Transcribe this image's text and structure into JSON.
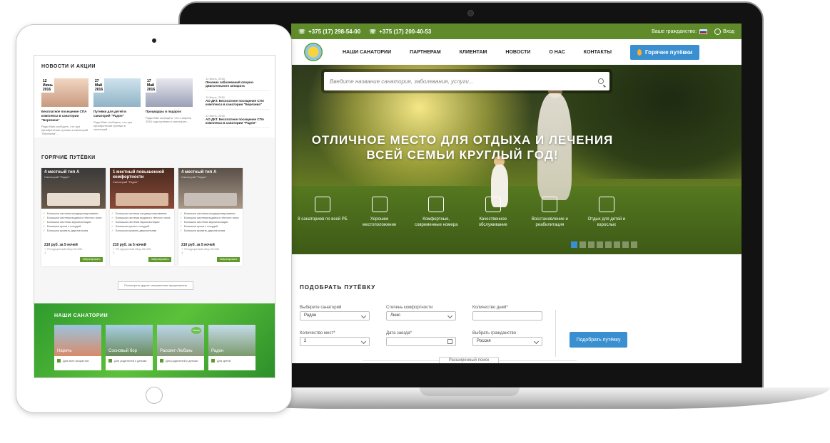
{
  "laptop": {
    "topbar": {
      "phone1": "+375 (17) 298-54-00",
      "phone2": "+375 (17) 200-40-53",
      "citizenship_label": "Ваше гражданство:",
      "login": "Вход"
    },
    "nav": {
      "items": [
        "НАШИ САНАТОРИИ",
        "ПАРТНЕРАМ",
        "КЛИЕНТАМ",
        "НОВОСТИ",
        "О НАС",
        "КОНТАКТЫ"
      ],
      "hot_button": "Горячие путёвки"
    },
    "hero": {
      "search_placeholder": "Введите название санатория, заболевания, услуги...",
      "headline_line1": "ОТЛИЧНОЕ МЕСТО ДЛЯ ОТДЫХА И ЛЕЧЕНИЯ",
      "headline_line2": "ВСЕЙ СЕМЬИ КРУГЛЫЙ ГОД!",
      "features": [
        {
          "label": "8 санаториев по всей РБ",
          "icon": "building-icon"
        },
        {
          "label": "Хорошее местоположение",
          "icon": "forest-icon"
        },
        {
          "label": "Комфортные, современные номера",
          "icon": "sofa-icon"
        },
        {
          "label": "Качественное обслуживание",
          "icon": "service-icon"
        },
        {
          "label": "Восстановление и реабилитация",
          "icon": "rehab-icon"
        },
        {
          "label": "Отдых для детей и взрослых",
          "icon": "family-icon"
        }
      ]
    },
    "form": {
      "title": "ПОДОБРАТЬ ПУТЁВКУ",
      "sanatorium_label": "Выберите санаторий",
      "sanatorium_value": "Радон",
      "comfort_label": "Степень комфортности",
      "comfort_value": "Люкс",
      "days_label": "Количество дней*",
      "places_label": "Количество мест*",
      "places_value": "2",
      "date_label": "Дата заезда*",
      "citizenship_label": "Выбрать гражданство",
      "citizenship_value": "Россия",
      "submit": "Подобрать путёвку",
      "advanced": "Расширенный поиск"
    }
  },
  "tablet": {
    "news": {
      "title": "НОВОСТИ И АКЦИИ",
      "items": [
        {
          "day": "12",
          "month": "Июнь",
          "year": "2016",
          "title": "Бесплатное посещение СПА комплекса в санатории \"Березина\"",
          "text": "Рады Вам сообщить, что при приобретении путевки в санаторий \"Березина\"..."
        },
        {
          "day": "27",
          "month": "Май",
          "year": "2016",
          "title": "Путевки для детей в санаторий \"Радон\"",
          "text": "Рады Вам сообщить, что при приобретении путевки в санаторий..."
        },
        {
          "day": "17",
          "month": "Май",
          "year": "2016",
          "title": "Процедуры в подарок",
          "text": "Рады Вам сообщить, что с апреля 2016 года путевки в санатории..."
        }
      ],
      "side": [
        {
          "date": "12 Июнь, 2016",
          "title": "Лечение заболеваний опорно-двигательного аппарата"
        },
        {
          "date": "12 Июнь, 2016",
          "title": "АО ДКТ. Бесплатное посещение СПА комплекса в санатории \"Березина\""
        },
        {
          "date": "12 Июнь, 2016",
          "title": "АО ДКТ. Бесплатное посещение СПА комплекса в санатории \"Радон\""
        }
      ]
    },
    "hot": {
      "title": "ГОРЯЧИЕ ПУТЁВКИ",
      "cards": [
        {
          "name": "4 местный тип А",
          "san": "Санаторий \"Радон\"",
          "price": "210 руб. за 5 ночей",
          "sub": "+ 7% курортный сбор 20.000",
          "qty": "1",
          "book": "Забронировать"
        },
        {
          "name": "1 местный повышенной комфортности",
          "san": "Санаторий \"Радон\"",
          "price": "210 руб. за 5 ночей",
          "sub": "+ 7% курортный сбор 20.000",
          "qty": "1",
          "book": "Забронировать"
        },
        {
          "name": "4 местный тип А",
          "san": "Санаторий \"Радон\"",
          "price": "210 руб. за 5 ночей",
          "sub": "+ 7% курортный сбор 20.000",
          "qty": "1",
          "book": "Забронировать"
        }
      ],
      "features": [
        "Большая система кондиционирования",
        "Большая система водяного тёплого пола",
        "Большая система звукоизоляции",
        "Большая кухня с посудой",
        "Большая кровать-двуспальная"
      ],
      "more": "Посмотреть другие специальные предложения"
    },
    "sanatoriums": {
      "title": "НАШИ САНАТОРИИ",
      "cards": [
        {
          "name": "Нарочь",
          "feature": "Для всех возрастов"
        },
        {
          "name": "Сосновый бор",
          "feature": "Для родителей с детьми"
        },
        {
          "name": "Рассвет-Любань",
          "feature": "Для родителей с детьми",
          "badge": "Новое"
        },
        {
          "name": "Радон",
          "feature": "Для детей"
        }
      ]
    }
  }
}
